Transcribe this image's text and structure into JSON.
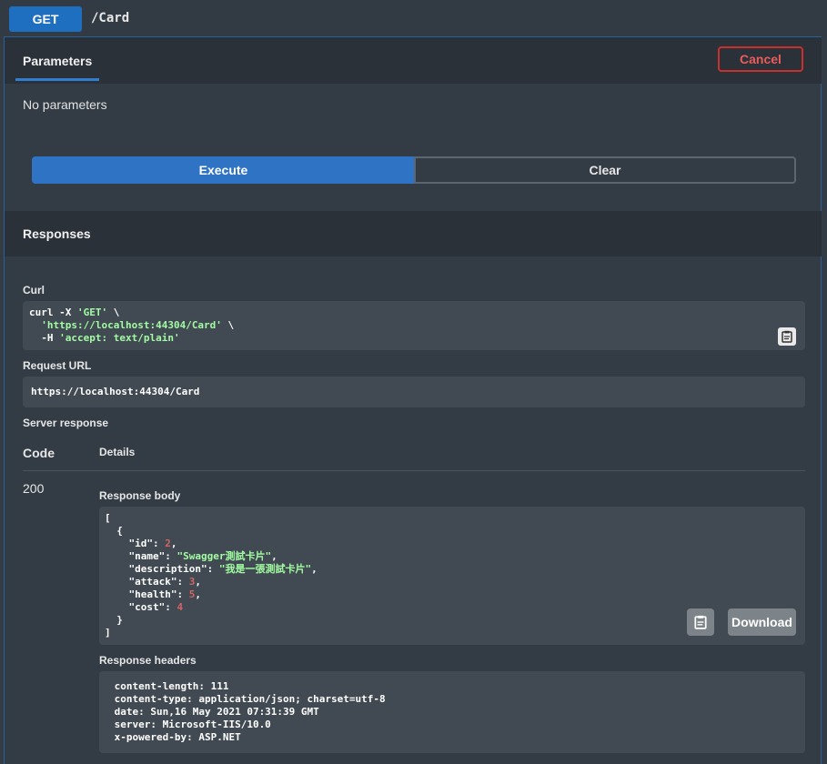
{
  "operation": {
    "method": "GET",
    "path": "/Card"
  },
  "parameters": {
    "tab_label": "Parameters",
    "cancel_label": "Cancel",
    "empty_text": "No parameters"
  },
  "actions": {
    "execute_label": "Execute",
    "clear_label": "Clear"
  },
  "responses": {
    "title": "Responses",
    "curl_label": "Curl",
    "curl": {
      "line1_cmd": "curl -X ",
      "line1_str": "'GET'",
      "line1_end": " \\",
      "line2_indent": "  ",
      "line2_str": "'https://localhost:44304/Card'",
      "line2_end": " \\",
      "line3_cmd": "  -H ",
      "line3_str": "'accept: text/plain'"
    },
    "request_url_label": "Request URL",
    "request_url": "https://localhost:44304/Card",
    "server_response_label": "Server response",
    "code_header": "Code",
    "details_header": "Details",
    "status_code": "200",
    "response_body_label": "Response body",
    "body": {
      "open_bracket": "[",
      "open_brace": "  {",
      "id_key": "    \"id\": ",
      "id_val": "2",
      "name_key": "    \"name\": ",
      "name_val": "\"Swagger測試卡片\"",
      "desc_key": "    \"description\": ",
      "desc_val": "\"我是一張測試卡片\"",
      "attack_key": "    \"attack\": ",
      "attack_val": "3",
      "health_key": "    \"health\": ",
      "health_val": "5",
      "cost_key": "    \"cost\": ",
      "cost_val": "4",
      "close_brace": "  }",
      "close_bracket": "]"
    },
    "download_label": "Download",
    "response_headers_label": "Response headers",
    "headers": [
      " content-length: 111 ",
      " content-type: application/json; charset=utf-8 ",
      " date: Sun,16 May 2021 07:31:39 GMT ",
      " server: Microsoft-IIS/10.0 ",
      " x-powered-by: ASP.NET "
    ]
  },
  "icons": {
    "copy": "clipboard-icon"
  },
  "colors": {
    "get_method": "#1f6fc1",
    "cancel": "#c9302c",
    "execute": "#2f74c4",
    "string": "#a2fca2",
    "number": "#d36363"
  }
}
